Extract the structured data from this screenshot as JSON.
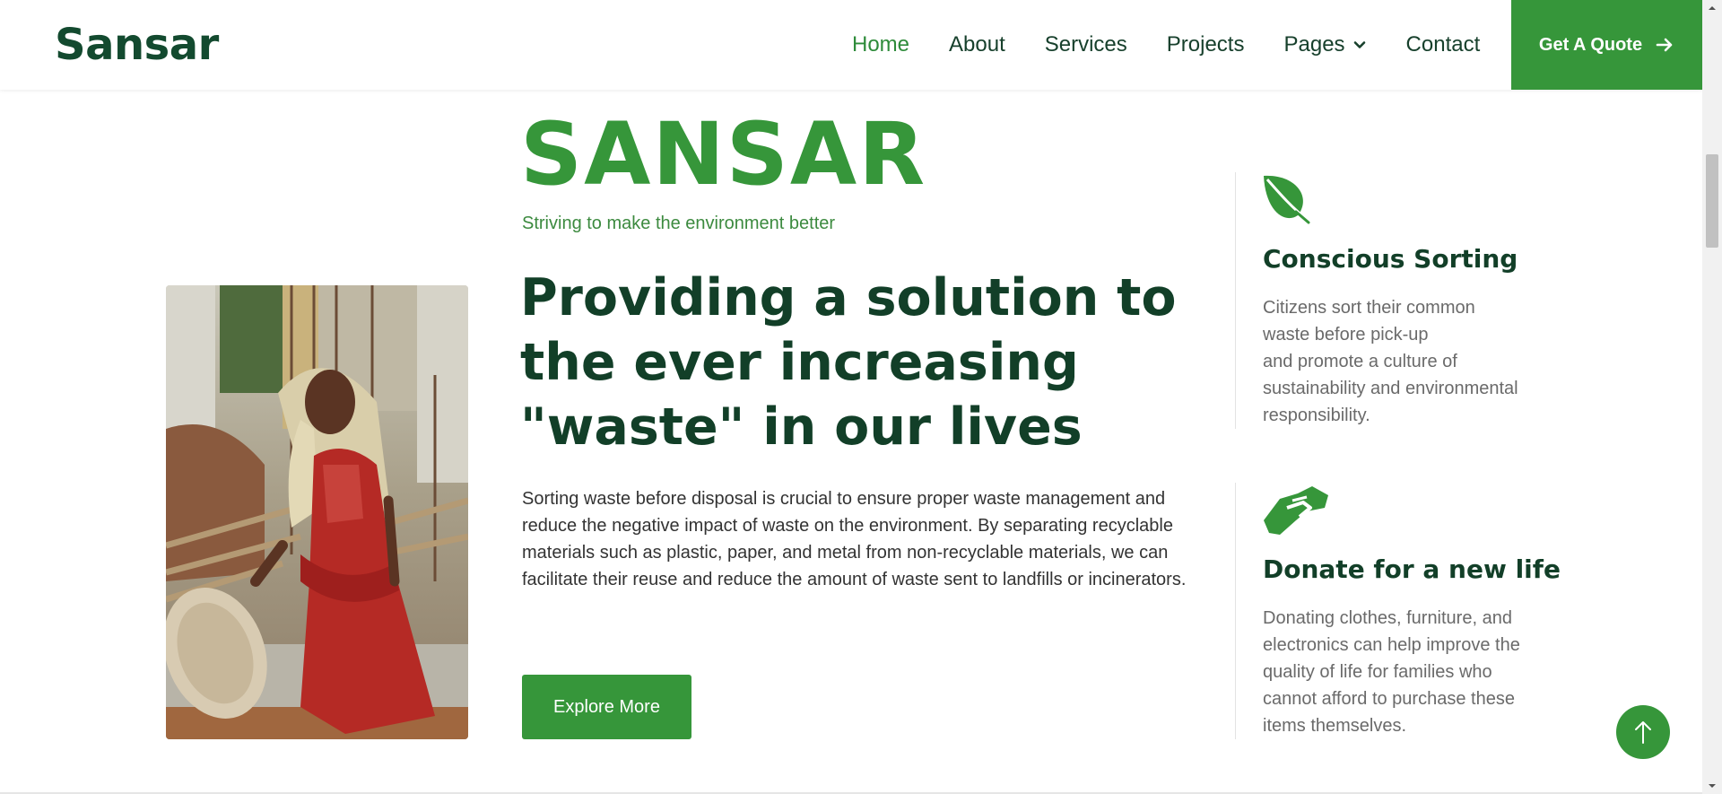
{
  "brand": {
    "name": "Sansar"
  },
  "nav": {
    "items": [
      {
        "label": "Home",
        "active": true
      },
      {
        "label": "About"
      },
      {
        "label": "Services"
      },
      {
        "label": "Projects"
      },
      {
        "label": "Pages",
        "has_dropdown": true
      },
      {
        "label": "Contact"
      }
    ],
    "cta_label": "Get A Quote",
    "cta_icon": "arrow-right-icon"
  },
  "hero": {
    "title": "SANSAR",
    "tagline": "Striving to make the environment better",
    "headline": "Providing a solution to the ever increasing \"waste\" in our lives",
    "paragraph": "Sorting waste before disposal is crucial to ensure proper waste management and reduce the negative impact of waste on the environment. By separating recyclable materials such as plastic, paper, and metal from non-recyclable materials, we can facilitate their reuse and reduce the amount of waste sent to landfills or incinerators.",
    "button_label": "Explore More",
    "image_alt": "woman-waste-worker-photo"
  },
  "features": [
    {
      "icon": "leaf-icon",
      "title": "Conscious Sorting",
      "lines": [
        "Citizens sort their common",
        "waste before pick-up",
        "and promote a culture of",
        "sustainability and environmental",
        "responsibility."
      ]
    },
    {
      "icon": "handshake-icon",
      "title": "Donate for a new life",
      "lines": [
        "Donating clothes, furniture, and",
        "electronics can help improve the",
        "quality of life for families who",
        "cannot afford to purchase these",
        "items themselves."
      ]
    }
  ],
  "back_to_top_icon": "arrow-up-icon",
  "colors": {
    "primary": "#36963a",
    "dark_green": "#123f28",
    "text_gray": "#6a6a6a"
  }
}
